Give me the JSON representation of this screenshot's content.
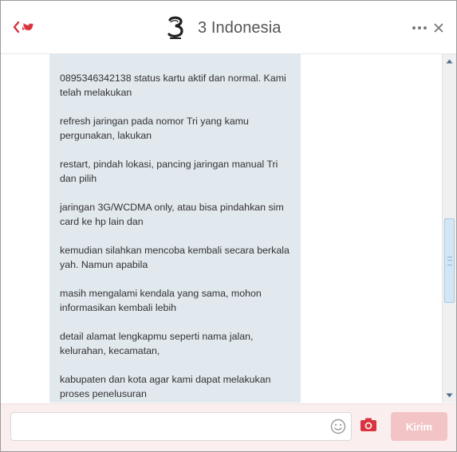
{
  "header": {
    "title": "3 Indonesia",
    "logo_text": "3"
  },
  "messages": [
    "0895346342138 status kartu aktif dan normal. Kami telah melakukan",
    "refresh jaringan pada nomor Tri yang kamu pergunakan, lakukan",
    "restart, pindah lokasi, pancing jaringan manual Tri dan pilih",
    "jaringan 3G/WCDMA only, atau bisa pindahkan sim card ke hp lain dan",
    "kemudian silahkan mencoba kembali secara berkala yah. Namun apabila",
    "masih mengalami kendala yang sama, mohon informasikan kembali lebih",
    "detail alamat lengkapmu seperti nama jalan, kelurahan, kecamatan,",
    "kabupaten dan kota agar kami dapat melakukan proses penelusuran"
  ],
  "composer": {
    "value": "",
    "placeholder": "",
    "send_label": "Kirim"
  },
  "icons": {
    "back": "back-chevron-icon",
    "twitter": "twitter-bird-icon",
    "more": "more-dots-icon",
    "close": "close-icon",
    "emoji": "emoji-icon",
    "camera": "camera-icon"
  },
  "colors": {
    "accent": "#d9333f",
    "bubble": "#e1e8ee",
    "footer": "#fbeeee",
    "send_button": "#f3c4c6"
  }
}
